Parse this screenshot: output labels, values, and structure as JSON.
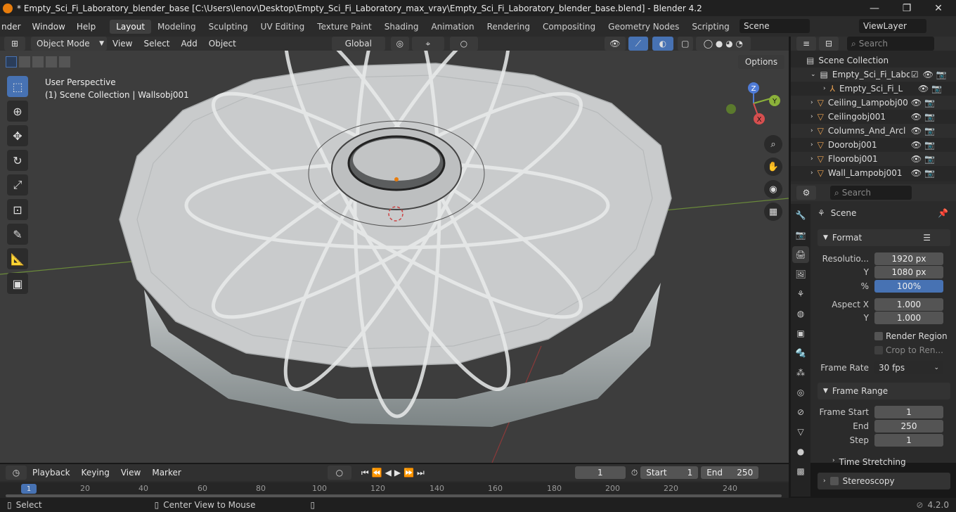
{
  "window": {
    "title": "* Empty_Sci_Fi_Laboratory_blender_base [C:\\Users\\lenov\\Desktop\\Empty_Sci_Fi_Laboratory_max_vray\\Empty_Sci_Fi_Laboratory_blender_base.blend] - Blender 4.2",
    "minimize": "—",
    "maximize": "❐",
    "close": "✕"
  },
  "menus": [
    "nder",
    "Window",
    "Help"
  ],
  "workspaces": [
    "Layout",
    "Modeling",
    "Sculpting",
    "UV Editing",
    "Texture Paint",
    "Shading",
    "Animation",
    "Rendering",
    "Compositing",
    "Geometry Nodes",
    "Scripting"
  ],
  "active_workspace": "Layout",
  "scene_field": "Scene",
  "viewlayer_field": "ViewLayer",
  "viewport_header": {
    "mode": "Object Mode",
    "menus": [
      "View",
      "Select",
      "Add",
      "Object"
    ],
    "transform": "Global",
    "options": "Options"
  },
  "viewport": {
    "perspective": "User Perspective",
    "collection": "(1) Scene Collection | Wallsobj001",
    "gizmo": {
      "x": "X",
      "y": "Y",
      "z": "Z"
    }
  },
  "outliner": {
    "search_placeholder": "Search",
    "root": "Scene Collection",
    "items": [
      {
        "label": "Empty_Sci_Fi_Labo",
        "indent": 1
      },
      {
        "label": "Empty_Sci_Fi_L",
        "indent": 2
      },
      {
        "label": "Ceiling_Lampobj00",
        "indent": 1
      },
      {
        "label": "Ceilingobj001",
        "indent": 1
      },
      {
        "label": "Columns_And_Arcl",
        "indent": 1
      },
      {
        "label": "Doorobj001",
        "indent": 1
      },
      {
        "label": "Floorobj001",
        "indent": 1
      },
      {
        "label": "Wall_Lampobj001",
        "indent": 1
      }
    ]
  },
  "properties": {
    "search_placeholder": "Search",
    "context": "Scene",
    "format": {
      "title": "Format",
      "resolution_label": "Resolutio...",
      "resolution_x": "1920 px",
      "y_label": "Y",
      "resolution_y": "1080 px",
      "percent_label": "%",
      "percent": "100%",
      "aspect_x_label": "Aspect X",
      "aspect_x": "1.000",
      "aspect_y_label": "Y",
      "aspect_y": "1.000",
      "render_region": "Render Region",
      "crop": "Crop to Ren...",
      "frame_rate_label": "Frame Rate",
      "frame_rate": "30 fps"
    },
    "frame_range": {
      "title": "Frame Range",
      "start_label": "Frame Start",
      "start": "1",
      "end_label": "End",
      "end": "250",
      "step_label": "Step",
      "step": "1"
    },
    "time_stretching": "Time Stretching",
    "stereoscopy": "Stereoscopy"
  },
  "timeline": {
    "menus": [
      "Playback",
      "Keying",
      "View",
      "Marker"
    ],
    "current_frame": "1",
    "start_label": "Start",
    "start": "1",
    "end_label": "End",
    "end": "250",
    "ruler": [
      "1",
      "20",
      "40",
      "60",
      "80",
      "100",
      "120",
      "140",
      "160",
      "180",
      "200",
      "220",
      "240"
    ]
  },
  "statusbar": {
    "select": "Select",
    "center_view": "Center View to Mouse",
    "version": "4.2.0"
  },
  "colors": {
    "accent": "#4772b3",
    "orange": "#e87d0d"
  }
}
